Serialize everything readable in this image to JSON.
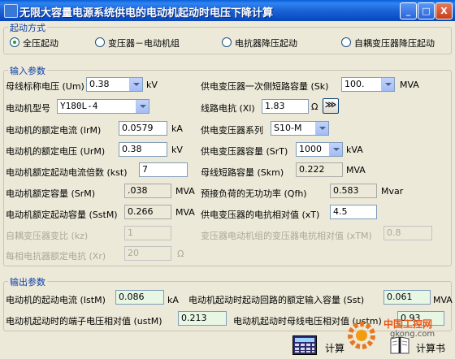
{
  "window": {
    "title": "无限大容量电源系统供电的电动机起动时电压下降计算",
    "min_label": "_",
    "max_label": "□",
    "close_label": "X"
  },
  "start_mode": {
    "legend": "起动方式",
    "options": [
      "全压起动",
      "变压器－电动机组",
      "电抗器降压起动",
      "自耦变压器降压起动"
    ],
    "selected_index": 0
  },
  "input": {
    "legend": "输入参数",
    "bus_voltage": {
      "label": "母线标称电压 (Um)",
      "value": "0.38",
      "unit": "kV"
    },
    "motor_model": {
      "label": "电动机型号",
      "value": "Y180L-4"
    },
    "rated_current": {
      "label": "电动机的额定电流 (IrM)",
      "value": "0.0579",
      "unit": "kA"
    },
    "rated_voltage": {
      "label": "电动机的额定电压 (UrM)",
      "value": "0.38",
      "unit": "kV"
    },
    "start_multiple": {
      "label": "电动机额定起动电流倍数 (kst)",
      "value": "7"
    },
    "rated_capacity": {
      "label": "电动机额定容量 (SrM)",
      "value": ".038",
      "unit": "MVA"
    },
    "rated_start_capacity": {
      "label": "电动机额定起动容量 (SstM)",
      "value": "0.266",
      "unit": "MVA"
    },
    "autotransformer_ratio": {
      "label": "自耦变压器变比 (kz)",
      "value": "1"
    },
    "reactor_reactance": {
      "label": "每相电抗器额定电抗 (Xr)",
      "value": "20",
      "unit": "Ω"
    },
    "primary_sc_capacity": {
      "label": "供电变压器一次侧短路容量 (Sk)",
      "value": "100.",
      "unit": "MVA"
    },
    "line_reactance": {
      "label": "线路电抗 (Xl)",
      "value": "1.83",
      "unit": "Ω",
      "button": "⋙"
    },
    "transformer_series": {
      "label": "供电变压器系列",
      "value": "S10-M"
    },
    "transformer_capacity": {
      "label": "供电变压器容量 (SrT)",
      "value": "1000",
      "unit": "kVA"
    },
    "bus_sc_capacity": {
      "label": "母线短路容量 (Skm)",
      "value": "0.222",
      "unit": "MVA"
    },
    "preload_reactive": {
      "label": "预接负荷的无功功率 (Qfh)",
      "value": "0.583",
      "unit": "Mvar"
    },
    "transformer_reactance": {
      "label": "供电变压器的电抗相对值 (xT)",
      "value": "4.5"
    },
    "motor_group_reactance": {
      "label": "变压器电动机组的变压器电抗相对值 (xTM)",
      "value": "0.8"
    }
  },
  "output": {
    "legend": "输出参数",
    "start_current": {
      "label": "电动机的起动电流 (IstM)",
      "value": "0.086",
      "unit": "kA"
    },
    "terminal_voltage": {
      "label": "电动机起动时的端子电压相对值 (ustM)",
      "value": "0.213"
    },
    "loop_input_capacity": {
      "label": "电动机起动时起动回路的额定输入容量 (Sst)",
      "value": "0.061",
      "unit": "MVA"
    },
    "bus_voltage_ratio": {
      "label": "电动机起动时母线电压相对值 (ustm)",
      "value": "0.93"
    }
  },
  "buttons": {
    "calculate": "计算",
    "calc_book": "计算书"
  },
  "watermark": {
    "line1": "中国工控网",
    "line2": "gkong.com"
  }
}
